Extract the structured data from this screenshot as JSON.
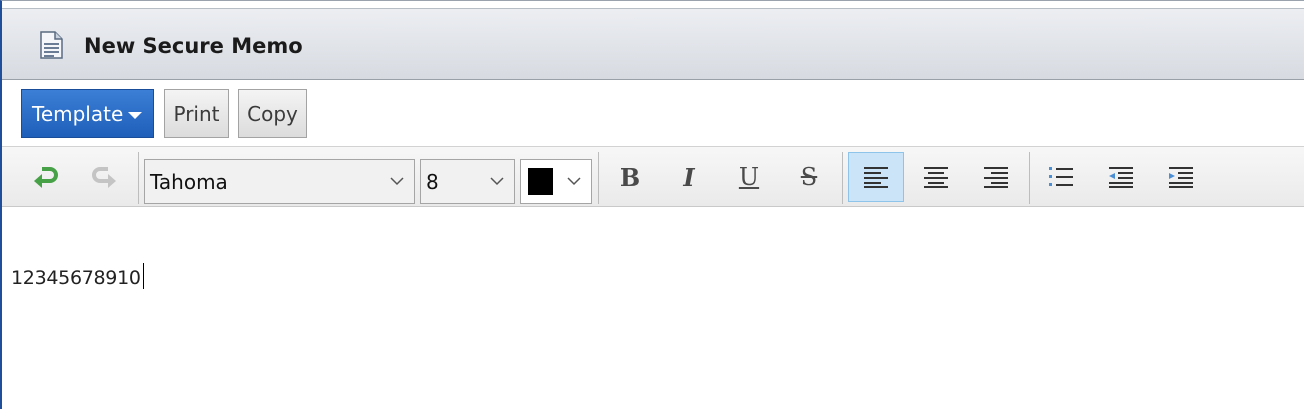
{
  "window": {
    "title": "New Secure Memo",
    "title_icon": "document-icon",
    "accent_color": "#1f5fba"
  },
  "actions": {
    "template_label": "Template",
    "print_label": "Print",
    "copy_label": "Copy"
  },
  "format_toolbar": {
    "undo_icon": "undo-icon",
    "redo_icon": "redo-icon",
    "font_family": "Tahoma",
    "font_size": "8",
    "text_color": "#000000",
    "bold_label": "B",
    "italic_label": "I",
    "underline_label": "U",
    "strikethrough_label": "S",
    "active_alignment": "left"
  },
  "editor": {
    "content": "12345678910"
  }
}
